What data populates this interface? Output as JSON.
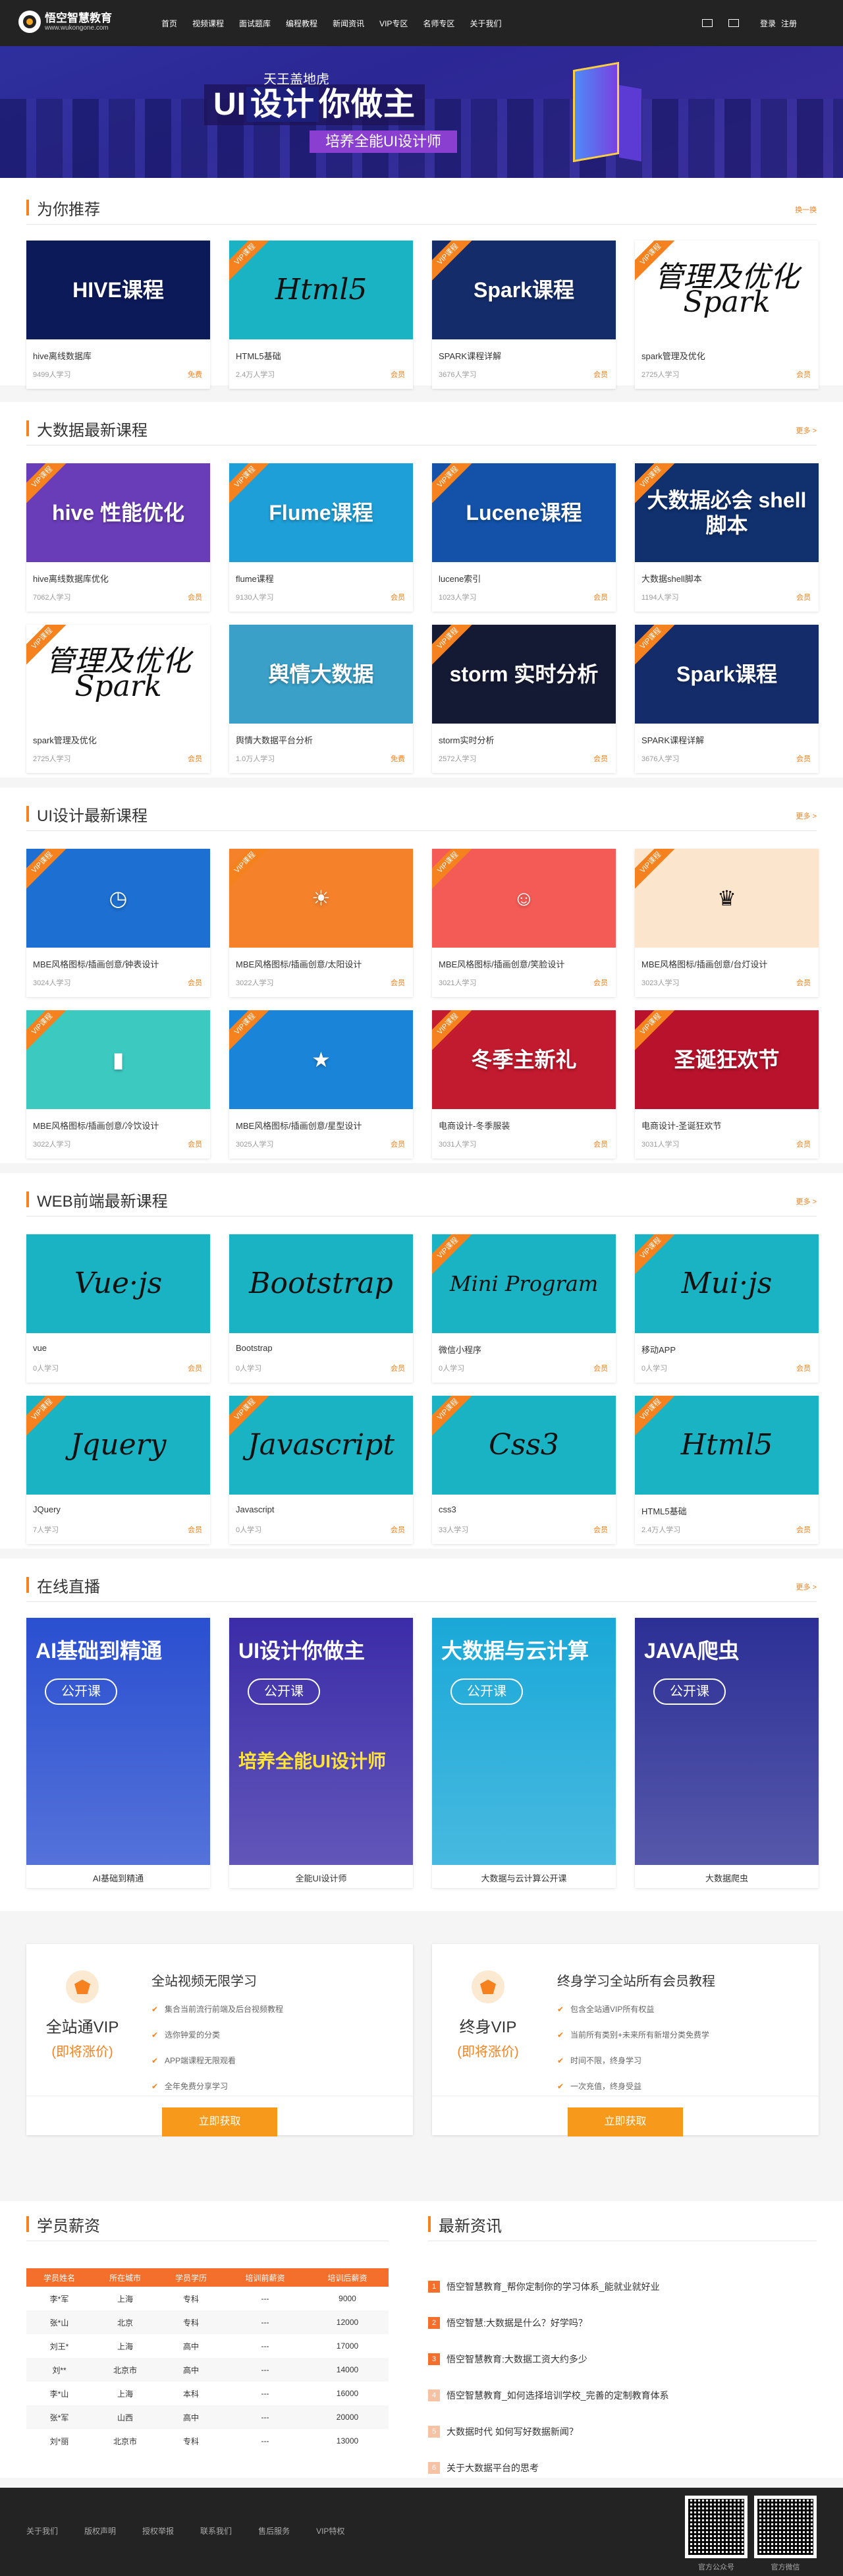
{
  "header": {
    "logo_name": "悟空智慧教育",
    "logo_url": "www.wukongone.com",
    "nav": [
      "首页",
      "视频课程",
      "面试题库",
      "编程教程",
      "新闻资讯",
      "VIP专区",
      "名师专区",
      "关于我们"
    ],
    "login": "登录",
    "register": "注册"
  },
  "banner": {
    "sub": "天王盖地虎",
    "main_a": "UI",
    "main_b": "设计",
    "main_c": "你做主",
    "tag": "培养全能UI设计师"
  },
  "recommend": {
    "title": "为你推荐",
    "more": "换一换",
    "cards": [
      {
        "img": "HIVE课程",
        "title": "hive离线数据库",
        "count": "9499人学习",
        "tag": "免费",
        "vip": false,
        "bg": "#0c1a5a",
        "style": "light"
      },
      {
        "img": "Html5",
        "title": "HTML5基础",
        "count": "2.4万人学习",
        "tag": "会员",
        "vip": true,
        "bg": "#1ab3c4",
        "style": "dark"
      },
      {
        "img": "Spark课程",
        "title": "SPARK课程详解",
        "count": "3676人学习",
        "tag": "会员",
        "vip": true,
        "bg": "#142c6a",
        "style": "light"
      },
      {
        "img": "管理及优化 Spark",
        "title": "spark管理及优化",
        "count": "2725人学习",
        "tag": "会员",
        "vip": true,
        "bg": "#ffffff",
        "style": "dark"
      }
    ]
  },
  "bigdata": {
    "title": "大数据最新课程",
    "more": "更多 >",
    "cards": [
      {
        "img": "hive 性能优化",
        "title": "hive离线数据库优化",
        "count": "7062人学习",
        "tag": "会员",
        "vip": true,
        "bg": "#6a3db8",
        "style": "light"
      },
      {
        "img": "Flume课程",
        "title": "flume课程",
        "count": "9130人学习",
        "tag": "会员",
        "vip": true,
        "bg": "#1e9fd8",
        "style": "light"
      },
      {
        "img": "Lucene课程",
        "title": "lucene索引",
        "count": "1023人学习",
        "tag": "会员",
        "vip": true,
        "bg": "#1352a8",
        "style": "light"
      },
      {
        "img": "大数据必会 shell脚本",
        "title": "大数据shell脚本",
        "count": "1194人学习",
        "tag": "会员",
        "vip": true,
        "bg": "#10306e",
        "style": "light"
      },
      {
        "img": "管理及优化 Spark",
        "title": "spark管理及优化",
        "count": "2725人学习",
        "tag": "会员",
        "vip": true,
        "bg": "#ffffff",
        "style": "dark"
      },
      {
        "img": "舆情大数据",
        "title": "舆情大数据平台分析",
        "count": "1.0万人学习",
        "tag": "免费",
        "vip": false,
        "bg": "#3aa0c8",
        "style": "light"
      },
      {
        "img": "storm 实时分析",
        "title": "storm实时分析",
        "count": "2572人学习",
        "tag": "会员",
        "vip": true,
        "bg": "#151a34",
        "style": "light"
      },
      {
        "img": "Spark课程",
        "title": "SPARK课程详解",
        "count": "3676人学习",
        "tag": "会员",
        "vip": true,
        "bg": "#142c6a",
        "style": "light"
      }
    ]
  },
  "ui": {
    "title": "UI设计最新课程",
    "more": "更多 >",
    "cards": [
      {
        "img": "◷",
        "title": "MBE风格图标/插画创意/钟表设计",
        "count": "3024人学习",
        "tag": "会员",
        "vip": true,
        "bg": "#1d6fd1",
        "style": "light"
      },
      {
        "img": "☀",
        "title": "MBE风格图标/插画创意/太阳设计",
        "count": "3022人学习",
        "tag": "会员",
        "vip": true,
        "bg": "#f5812b",
        "style": "light"
      },
      {
        "img": "☺",
        "title": "MBE风格图标/插画创意/笑脸设计",
        "count": "3021人学习",
        "tag": "会员",
        "vip": true,
        "bg": "#f45b56",
        "style": "light"
      },
      {
        "img": "♛",
        "title": "MBE风格图标/插画创意/台灯设计",
        "count": "3023人学习",
        "tag": "会员",
        "vip": true,
        "bg": "#fbe5cc",
        "style": "light"
      },
      {
        "img": "▮",
        "title": "MBE风格图标/插画创意/冷饮设计",
        "count": "3022人学习",
        "tag": "会员",
        "vip": true,
        "bg": "#3cc9c0",
        "style": "light"
      },
      {
        "img": "★",
        "title": "MBE风格图标/插画创意/星型设计",
        "count": "3025人学习",
        "tag": "会员",
        "vip": true,
        "bg": "#1a84d9",
        "style": "light"
      },
      {
        "img": "冬季主新礼",
        "title": "电商设计-冬季服装",
        "count": "3031人学习",
        "tag": "会员",
        "vip": true,
        "bg": "#c21a2e",
        "style": "light"
      },
      {
        "img": "圣诞狂欢节",
        "title": "电商设计-圣诞狂欢节",
        "count": "3031人学习",
        "tag": "会员",
        "vip": true,
        "bg": "#b8122c",
        "style": "light"
      }
    ]
  },
  "web": {
    "title": "WEB前端最新课程",
    "more": "更多 >",
    "cards": [
      {
        "img": "Vue·js",
        "title": "vue",
        "count": "0人学习",
        "tag": "会员",
        "vip": false,
        "bg": "#1ab3c4",
        "style": "dark"
      },
      {
        "img": "Bootstrap",
        "title": "Bootstrap",
        "count": "0人学习",
        "tag": "会员",
        "vip": false,
        "bg": "#1ab3c4",
        "style": "dark"
      },
      {
        "img": "Mini Program",
        "title": "微信小程序",
        "count": "0人学习",
        "tag": "会员",
        "vip": true,
        "bg": "#1ab3c4",
        "style": "dark small"
      },
      {
        "img": "Mui·js",
        "title": "移动APP",
        "count": "0人学习",
        "tag": "会员",
        "vip": true,
        "bg": "#1ab3c4",
        "style": "dark"
      },
      {
        "img": "Jquery",
        "title": "JQuery",
        "count": "7人学习",
        "tag": "会员",
        "vip": true,
        "bg": "#1ab3c4",
        "style": "dark"
      },
      {
        "img": "Javascript",
        "title": "Javascript",
        "count": "0人学习",
        "tag": "会员",
        "vip": true,
        "bg": "#1ab3c4",
        "style": "dark"
      },
      {
        "img": "Css3",
        "title": "css3",
        "count": "33人学习",
        "tag": "会员",
        "vip": true,
        "bg": "#1ab3c4",
        "style": "dark"
      },
      {
        "img": "Html5",
        "title": "HTML5基础",
        "count": "2.4万人学习",
        "tag": "会员",
        "vip": true,
        "bg": "#1ab3c4",
        "style": "dark"
      }
    ]
  },
  "live": {
    "title": "在线直播",
    "more": "更多 >",
    "badge": "公开课",
    "items": [
      {
        "head": "AI基础到精通",
        "strip": "",
        "name": "AI基础到精通",
        "bg": "#2a4fd0"
      },
      {
        "head": "UI设计你做主",
        "strip": "培养全能UI设计师",
        "name": "全能UI设计师",
        "bg": "#3b2ca8"
      },
      {
        "head": "大数据与云计算",
        "strip": "",
        "name": "大数据与云计算公开课",
        "bg": "#1aa8d8"
      },
      {
        "head": "JAVA爬虫",
        "strip": "",
        "name": "大数据爬虫",
        "bg": "#2c2f95"
      }
    ]
  },
  "vip": {
    "boxes": [
      {
        "name": "全站通VIP",
        "sub": "(即将涨价)",
        "title": "全站视频无限学习",
        "items": [
          "集合当前流行前端及后台视频教程",
          "选你钟爱的分类",
          "APP端课程无限观看",
          "全年免费分享学习"
        ],
        "btn": "立即获取"
      },
      {
        "name": "终身VIP",
        "sub": "(即将涨价)",
        "title": "终身学习全站所有会员教程",
        "items": [
          "包含全站通VIP所有权益",
          "当前所有类别+未来所有新增分类免费学",
          "时间不限，终身学习",
          "一次充值，终身受益"
        ],
        "btn": "立即获取"
      }
    ]
  },
  "salary": {
    "title": "学员薪资",
    "headers": [
      "学员姓名",
      "所在城市",
      "学员学历",
      "培训前薪资",
      "培训后薪资"
    ],
    "rows": [
      [
        "李*军",
        "上海",
        "专科",
        "---",
        "9000"
      ],
      [
        "张*山",
        "北京",
        "专科",
        "---",
        "12000"
      ],
      [
        "刘王*",
        "上海",
        "高中",
        "---",
        "17000"
      ],
      [
        "刘**",
        "北京市",
        "高中",
        "---",
        "14000"
      ],
      [
        "李*山",
        "上海",
        "本科",
        "---",
        "16000"
      ],
      [
        "张*军",
        "山西",
        "高中",
        "---",
        "20000"
      ],
      [
        "刘*丽",
        "北京市",
        "专科",
        "---",
        "13000"
      ]
    ]
  },
  "news": {
    "title": "最新资讯",
    "items": [
      "悟空智慧教育_帮你定制你的学习体系_能就业就好业",
      "悟空智慧:大数据是什么？好学吗？",
      "悟空智慧教育:大数据工资大约多少",
      "悟空智慧教育_如何选择培训学校_完善的定制教育体系",
      "大数据时代 如何写好数据新闻？",
      "关于大数据平台的思考"
    ]
  },
  "footer": {
    "links": [
      "关于我们",
      "版权声明",
      "授权举报",
      "联系我们",
      "售后服务",
      "VIP特权"
    ],
    "qr1": "官方公众号",
    "qr2": "官方微信"
  },
  "colors": {
    "accent": "#f5811f",
    "dark": "#232323"
  }
}
